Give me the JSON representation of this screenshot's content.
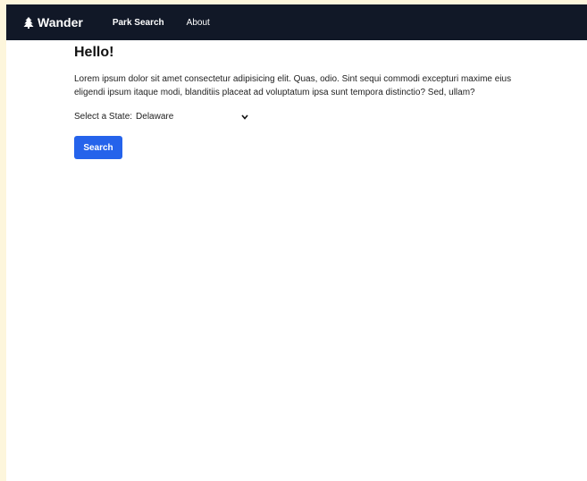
{
  "nav": {
    "brand": "Wander",
    "brand_icon": "tree-icon",
    "links": [
      "Park Search",
      "About"
    ]
  },
  "main": {
    "title": "Hello!",
    "intro": "Lorem ipsum dolor sit amet consectetur adipisicing elit. Quas, odio. Sint sequi commodi excepturi maxime eius eligendi ipsum itaque modi, blanditiis placeat ad voluptatum ipsa sunt tempora distinctio? Sed, ullam?",
    "state_label": "Select a State:",
    "state_value": "Delaware",
    "search_label": "Search"
  },
  "colors": {
    "page_background": "#fdf6dc",
    "navbar": "#111827",
    "button": "#2563eb"
  }
}
